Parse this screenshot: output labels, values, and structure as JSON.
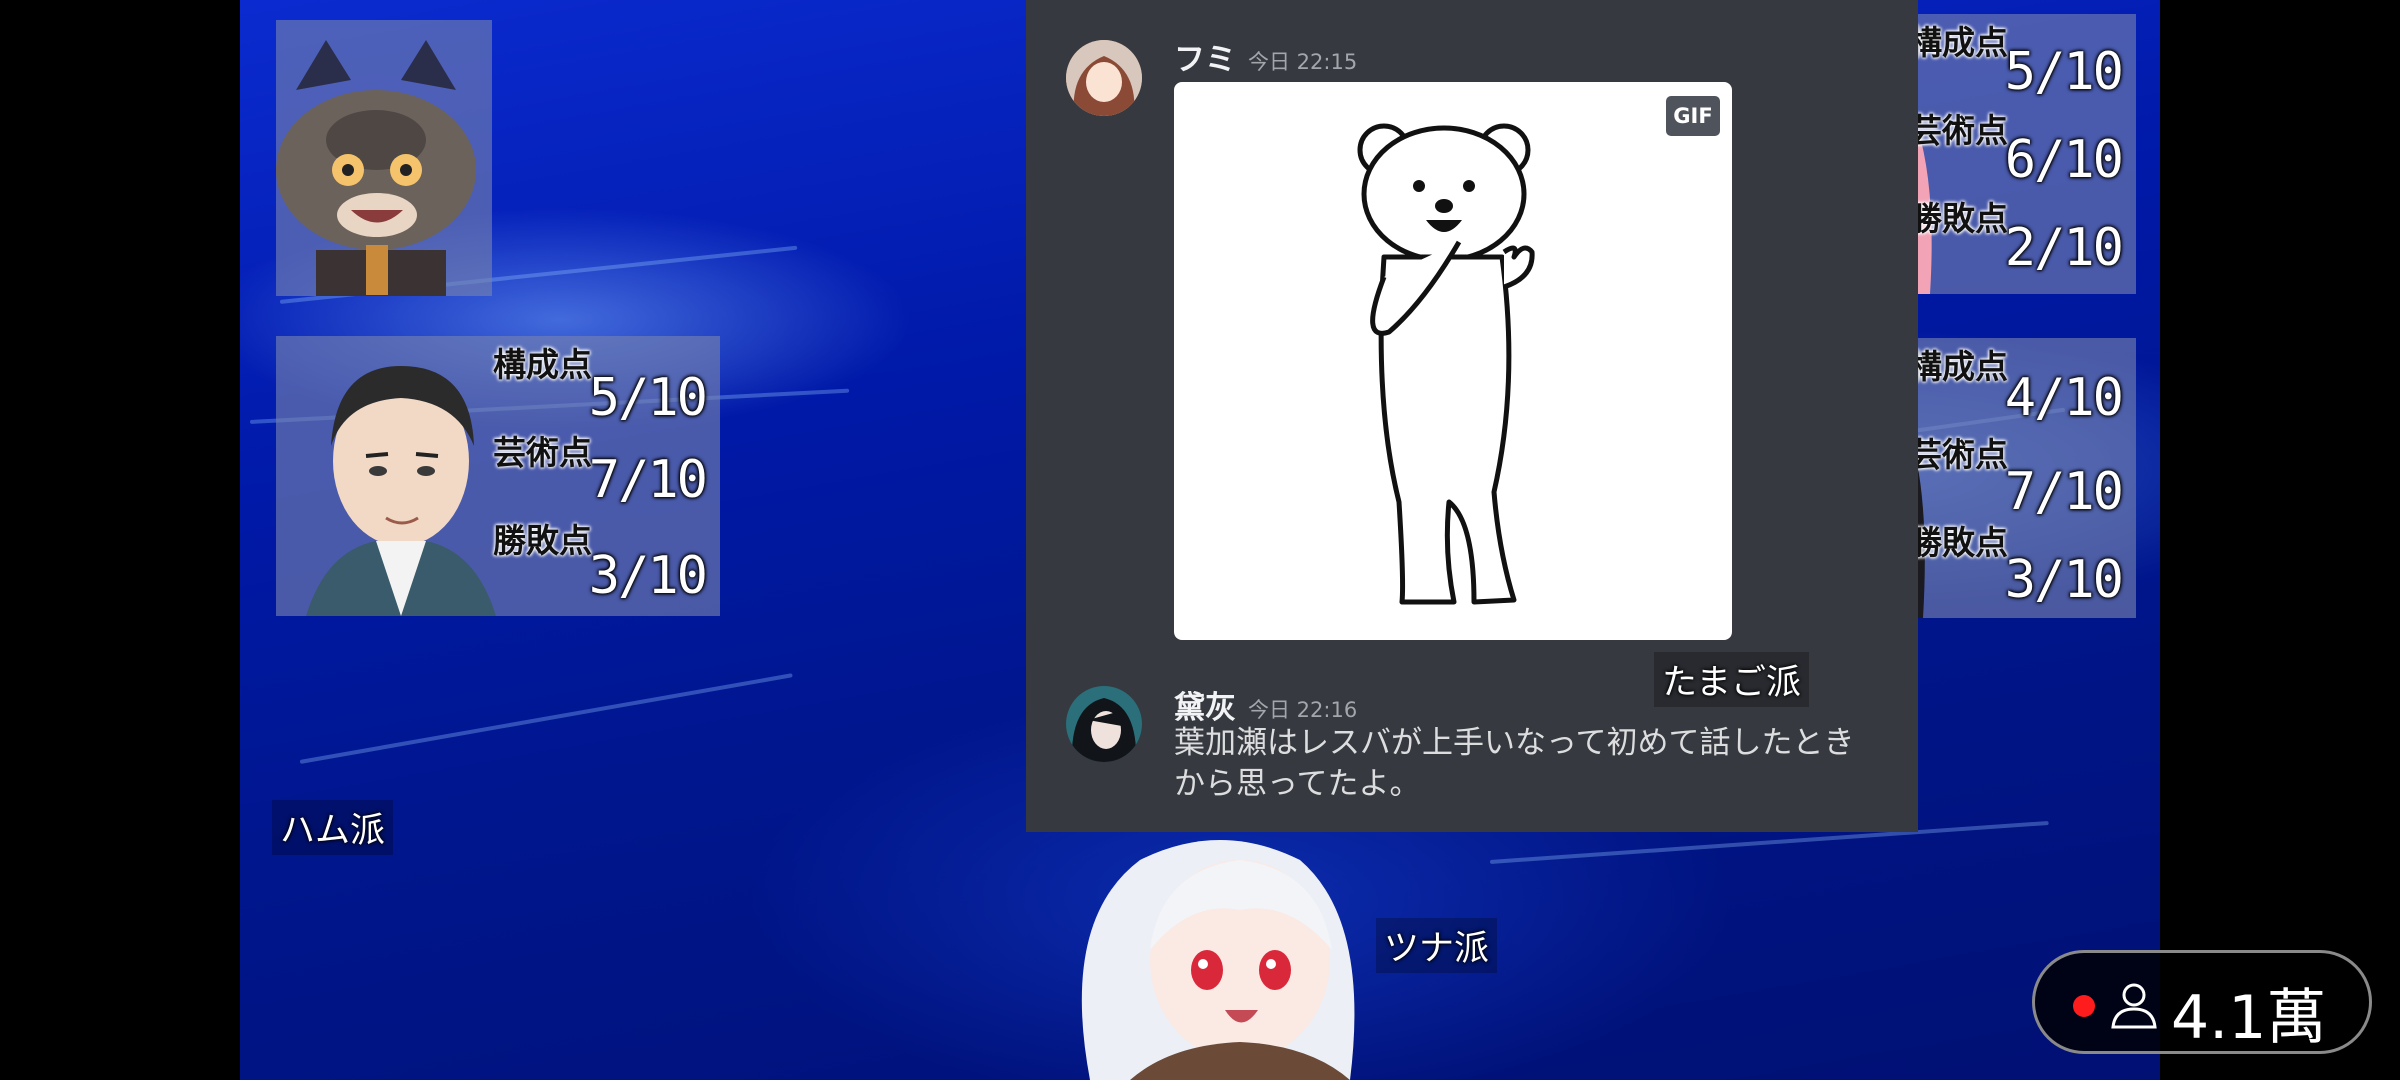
{
  "participants": [
    {
      "role": "top-left-avatar"
    },
    {
      "role": "left-host",
      "scores": [
        {
          "label": "構成点",
          "value": "5/10"
        },
        {
          "label": "芸術点",
          "value": "7/10"
        },
        {
          "label": "勝敗点",
          "value": "3/10"
        }
      ]
    },
    {
      "role": "right-pink",
      "scores": [
        {
          "label": "構成点",
          "value": "5/10"
        },
        {
          "label": "芸術点",
          "value": "6/10"
        },
        {
          "label": "勝敗点",
          "value": "2/10"
        }
      ]
    },
    {
      "role": "right-black",
      "scores": [
        {
          "label": "構成点",
          "value": "4/10"
        },
        {
          "label": "芸術点",
          "value": "7/10"
        },
        {
          "label": "勝敗点",
          "value": "3/10"
        }
      ]
    }
  ],
  "chat": {
    "messages": [
      {
        "author": "フミ",
        "time": "今日 22:15",
        "attachment_badge": "GIF"
      },
      {
        "author": "黛灰",
        "time": "今日 22:16",
        "text": "葉加瀬はレスバが上手いなって初めて話したときから思ってたよ。"
      }
    ]
  },
  "factions": {
    "ham": "ハム派",
    "tamago": "たまご派",
    "tuna": "ツナ派"
  },
  "viewer_badge": {
    "count": "4.1萬",
    "live_color": "#ff1c1c"
  },
  "colors": {
    "background_blue": "#0019a8",
    "chat_bg": "#36393f"
  }
}
